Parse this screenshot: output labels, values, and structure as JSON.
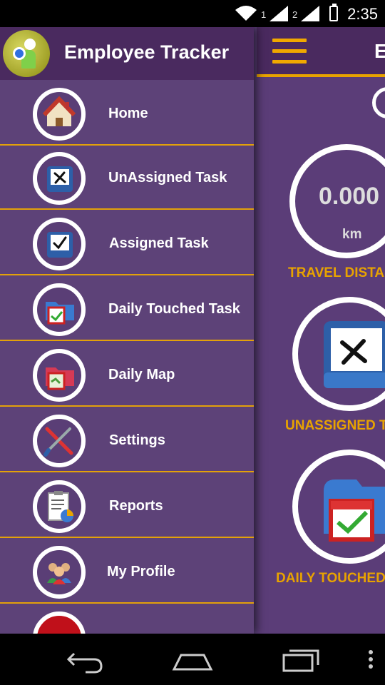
{
  "status_bar": {
    "time": "2:35",
    "sim1": "1",
    "sim2": "2",
    "icons": [
      "wifi-icon",
      "signal-icon",
      "signal-icon",
      "battery-icon"
    ]
  },
  "drawer": {
    "app_title": "Employee Tracker",
    "logo_icon": "app-logo-icon",
    "items": [
      {
        "label": "Home",
        "icon": "home-icon"
      },
      {
        "label": "UnAssigned Task",
        "icon": "unassigned-task-icon"
      },
      {
        "label": "Assigned Task",
        "icon": "assigned-task-icon"
      },
      {
        "label": "Daily Touched Task",
        "icon": "daily-touched-task-icon"
      },
      {
        "label": "Daily Map",
        "icon": "daily-map-icon"
      },
      {
        "label": "Settings",
        "icon": "settings-tools-icon"
      },
      {
        "label": "Reports",
        "icon": "reports-icon"
      },
      {
        "label": "My Profile",
        "icon": "my-profile-icon"
      },
      {
        "label": "",
        "icon": "logout-icon"
      }
    ]
  },
  "main": {
    "title_fragment": "E",
    "travel_distance_value": "0.000",
    "travel_distance_unit": "km",
    "travel_distance_label": "TRAVEL DISTA",
    "unassigned_label": "UNASSIGNED T",
    "daily_touched_label": "DAILY TOUCHED"
  },
  "colors": {
    "accent": "#e8a300",
    "toolbar": "#4a2a5f",
    "drawer_bg": "#5d4278",
    "main_bg": "#5b3d78"
  },
  "navbar": {
    "buttons": [
      "back-icon",
      "home-nav-icon",
      "recents-icon",
      "overflow-menu-icon"
    ]
  }
}
